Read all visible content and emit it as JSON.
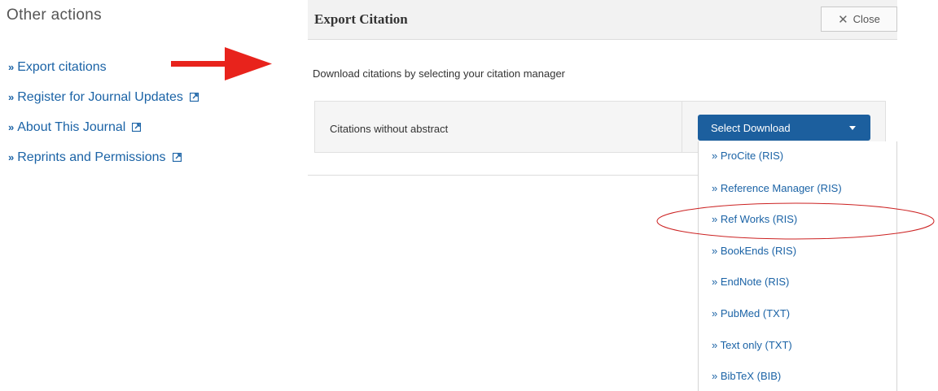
{
  "sidebar": {
    "title": "Other actions",
    "items": [
      {
        "label": "Export citations",
        "external": false
      },
      {
        "label": "Register for Journal Updates",
        "external": true
      },
      {
        "label": "About This Journal",
        "external": true
      },
      {
        "label": "Reprints and Permissions",
        "external": true
      }
    ]
  },
  "modal": {
    "title": "Export Citation",
    "close_label": "Close",
    "subtitle": "Download citations by selecting your citation manager",
    "row_label": "Citations without abstract",
    "download_button": "Select Download",
    "menu_items": [
      "» ProCite (RIS)",
      "» Reference Manager (RIS)",
      "» Ref Works (RIS)",
      "» BookEnds (RIS)",
      "» EndNote (RIS)",
      "» PubMed (TXT)",
      "» Text only (TXT)",
      "» BibTeX (BIB)"
    ],
    "highlighted_item": "» Ref Works (RIS)"
  },
  "colors": {
    "link": "#1b63a6",
    "button": "#1c5f9e",
    "arrow": "#e8231c",
    "highlight_ellipse": "#cc2222"
  },
  "icons": {
    "bullet": "double-chevron-right-icon",
    "external": "external-link-icon",
    "close": "close-icon",
    "caret": "caret-down-icon"
  }
}
